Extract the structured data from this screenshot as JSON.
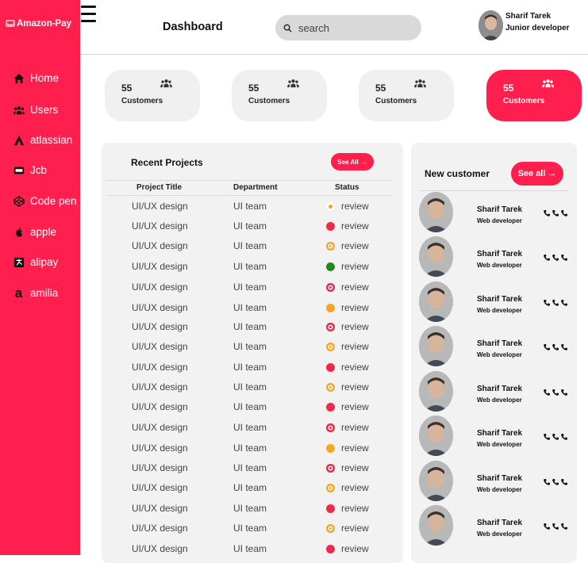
{
  "brand": {
    "name": "Amazon-Pay",
    "icon": "amazon-pay-icon"
  },
  "nav": [
    {
      "label": "Home",
      "icon": "home-icon"
    },
    {
      "label": "Users",
      "icon": "users-icon"
    },
    {
      "label": "atlassian",
      "icon": "atlassian-icon"
    },
    {
      "label": "Jcb",
      "icon": "jcb-icon"
    },
    {
      "label": "Code pen",
      "icon": "codepen-icon"
    },
    {
      "label": "apple",
      "icon": "apple-icon"
    },
    {
      "label": "alipay",
      "icon": "alipay-icon"
    },
    {
      "label": "amilia",
      "icon": "amilia-icon"
    }
  ],
  "header": {
    "title": "Dashboard",
    "search_placeholder": "search",
    "user_name": "Sharif Tarek",
    "user_role": "Junior developer"
  },
  "stats": [
    {
      "value": "55",
      "label": "Customers",
      "active": false
    },
    {
      "value": "55",
      "label": "Customers",
      "active": false
    },
    {
      "value": "55",
      "label": "Customers",
      "active": false
    },
    {
      "value": "55",
      "label": "Customers",
      "active": true
    }
  ],
  "projects": {
    "title": "Recent Projects",
    "see_all": "See All",
    "columns": [
      "Project Title",
      "Department",
      "Status"
    ],
    "rows": [
      {
        "title": "UI/UX design",
        "department": "UI team",
        "status": "review",
        "status_color": "#f5a623",
        "status_kind": "person"
      },
      {
        "title": "UI/UX design",
        "department": "UI team",
        "status": "review",
        "status_color": "#f0284a",
        "status_kind": "solid"
      },
      {
        "title": "UI/UX design",
        "department": "UI team",
        "status": "review",
        "status_color": "#f5a623",
        "status_kind": "ring"
      },
      {
        "title": "UI/UX design",
        "department": "UI team",
        "status": "review",
        "status_color": "#1d8a1d",
        "status_kind": "solid"
      },
      {
        "title": "UI/UX design",
        "department": "UI team",
        "status": "review",
        "status_color": "#f0284a",
        "status_kind": "ring"
      },
      {
        "title": "UI/UX design",
        "department": "UI team",
        "status": "review",
        "status_color": "#f5a623",
        "status_kind": "solid"
      },
      {
        "title": "UI/UX design",
        "department": "UI team",
        "status": "review",
        "status_color": "#f0284a",
        "status_kind": "ring"
      },
      {
        "title": "UI/UX design",
        "department": "UI team",
        "status": "review",
        "status_color": "#f5a623",
        "status_kind": "ring"
      },
      {
        "title": "UI/UX design",
        "department": "UI team",
        "status": "review",
        "status_color": "#f0284a",
        "status_kind": "solid"
      },
      {
        "title": "UI/UX design",
        "department": "UI team",
        "status": "review",
        "status_color": "#f5a623",
        "status_kind": "ring"
      },
      {
        "title": "UI/UX design",
        "department": "UI team",
        "status": "review",
        "status_color": "#f0284a",
        "status_kind": "solid"
      },
      {
        "title": "UI/UX design",
        "department": "UI team",
        "status": "review",
        "status_color": "#f0284a",
        "status_kind": "ring"
      },
      {
        "title": "UI/UX design",
        "department": "UI team",
        "status": "review",
        "status_color": "#f5a623",
        "status_kind": "solid"
      },
      {
        "title": "UI/UX design",
        "department": "UI team",
        "status": "review",
        "status_color": "#f0284a",
        "status_kind": "ring"
      },
      {
        "title": "UI/UX design",
        "department": "UI team",
        "status": "review",
        "status_color": "#f5a623",
        "status_kind": "ring"
      },
      {
        "title": "UI/UX design",
        "department": "UI team",
        "status": "review",
        "status_color": "#f0284a",
        "status_kind": "solid"
      },
      {
        "title": "UI/UX design",
        "department": "UI team",
        "status": "review",
        "status_color": "#f5a623",
        "status_kind": "ring"
      },
      {
        "title": "UI/UX design",
        "department": "UI team",
        "status": "review",
        "status_color": "#f0284a",
        "status_kind": "solid"
      }
    ]
  },
  "customers": {
    "title": "New customer",
    "see_all": "See all",
    "items": [
      {
        "name": "Sharif Tarek",
        "role": "Web developer"
      },
      {
        "name": "Sharif Tarek",
        "role": "Web developer"
      },
      {
        "name": "Sharif Tarek",
        "role": "Web developer"
      },
      {
        "name": "Sharif Tarek",
        "role": "Web developer"
      },
      {
        "name": "Sharif Tarek",
        "role": "Web developer"
      },
      {
        "name": "Sharif Tarek",
        "role": "Web developer"
      },
      {
        "name": "Sharif Tarek",
        "role": "Web developer"
      },
      {
        "name": "Sharif Tarek",
        "role": "Web developer"
      }
    ]
  },
  "colors": {
    "accent": "#ff1f4e",
    "panel": "#f2f2f2",
    "card": "#f0f0f0"
  }
}
